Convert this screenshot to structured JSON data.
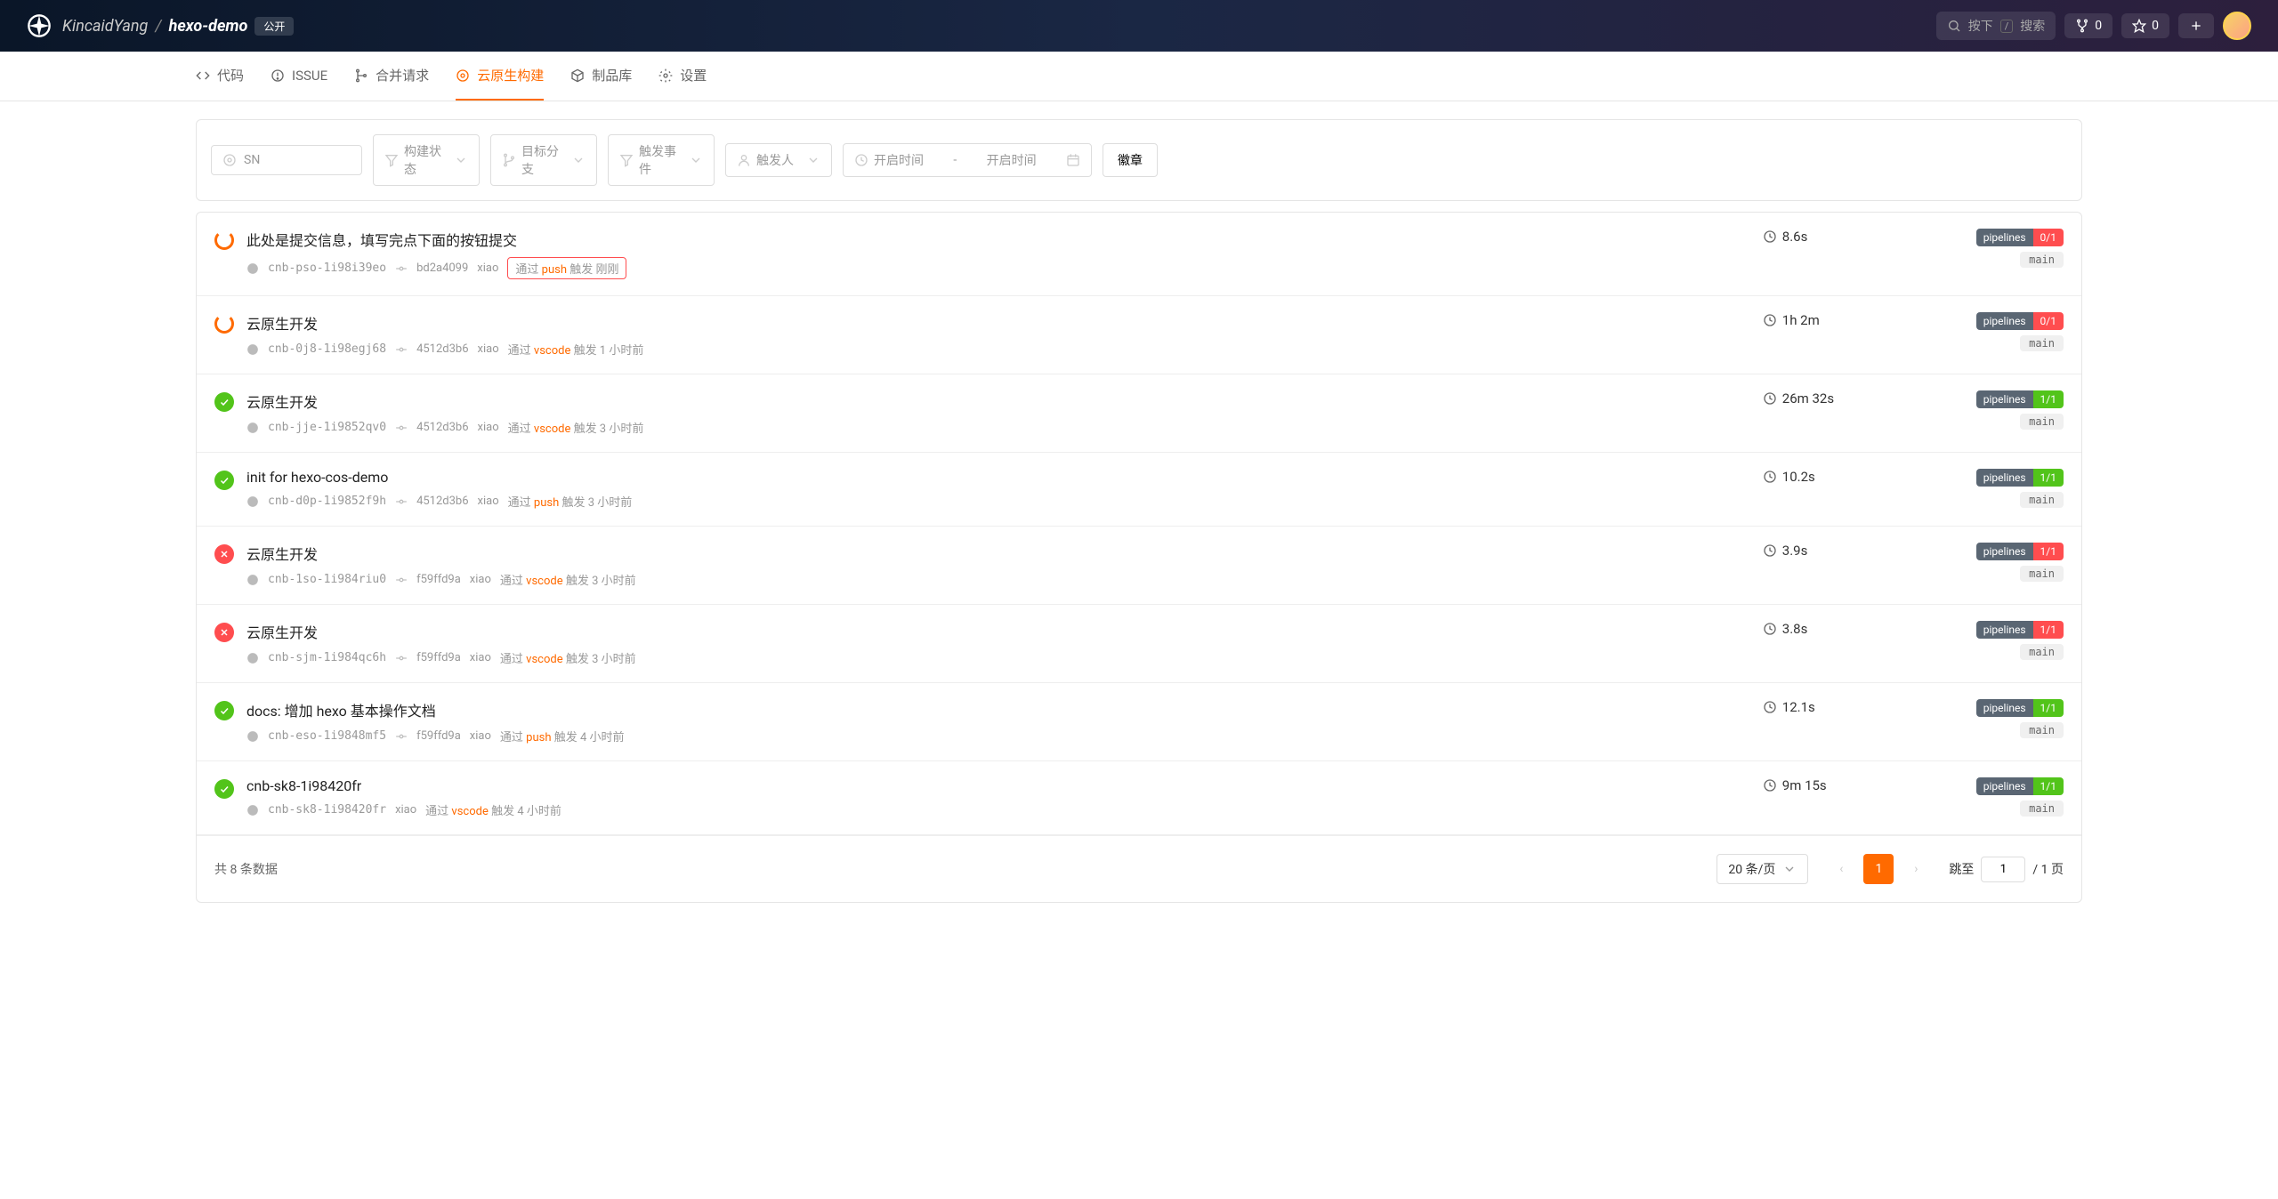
{
  "header": {
    "owner": "KincaidYang",
    "repo": "hexo-demo",
    "visibility": "公开",
    "search_placeholder": "按下",
    "search_suffix": "搜索",
    "fork_count": "0",
    "star_count": "0"
  },
  "tabs": {
    "code": "代码",
    "issue": "ISSUE",
    "pr": "合并请求",
    "build": "云原生构建",
    "artifact": "制品库",
    "settings": "设置"
  },
  "filters": {
    "sn_placeholder": "SN",
    "status": "构建状态",
    "branch": "目标分支",
    "event": "触发事件",
    "trigger": "触发人",
    "start_time": "开启时间",
    "end_time": "开启时间",
    "badge_btn": "徽章"
  },
  "builds": [
    {
      "status": "running",
      "title": "此处是提交信息，填写完点下面的按钮提交",
      "build_id": "cnb-pso-1i98i39eo",
      "commit": "bd2a4099",
      "user": "xiao",
      "trigger_prefix": "通过",
      "trigger_type": "push",
      "trigger_suffix": "触发 刚刚",
      "highlighted": true,
      "duration": "8.6s",
      "pipeline_count": "0/1",
      "pipeline_color": "red",
      "branch": "main"
    },
    {
      "status": "running",
      "title": "云原生开发",
      "build_id": "cnb-0j8-1i98egj68",
      "commit": "4512d3b6",
      "user": "xiao",
      "trigger_prefix": "通过",
      "trigger_type": "vscode",
      "trigger_suffix": "触发 1 小时前",
      "highlighted": false,
      "duration": "1h 2m",
      "pipeline_count": "0/1",
      "pipeline_color": "red",
      "branch": "main"
    },
    {
      "status": "success",
      "title": "云原生开发",
      "build_id": "cnb-jje-1i9852qv0",
      "commit": "4512d3b6",
      "user": "xiao",
      "trigger_prefix": "通过",
      "trigger_type": "vscode",
      "trigger_suffix": "触发 3 小时前",
      "highlighted": false,
      "duration": "26m 32s",
      "pipeline_count": "1/1",
      "pipeline_color": "green",
      "branch": "main"
    },
    {
      "status": "success",
      "title": "init for hexo-cos-demo",
      "build_id": "cnb-d0p-1i9852f9h",
      "commit": "4512d3b6",
      "user": "xiao",
      "trigger_prefix": "通过",
      "trigger_type": "push",
      "trigger_suffix": "触发 3 小时前",
      "highlighted": false,
      "duration": "10.2s",
      "pipeline_count": "1/1",
      "pipeline_color": "green",
      "branch": "main"
    },
    {
      "status": "fail",
      "title": "云原生开发",
      "build_id": "cnb-1so-1i984riu0",
      "commit": "f59ffd9a",
      "user": "xiao",
      "trigger_prefix": "通过",
      "trigger_type": "vscode",
      "trigger_suffix": "触发 3 小时前",
      "highlighted": false,
      "duration": "3.9s",
      "pipeline_count": "1/1",
      "pipeline_color": "red",
      "branch": "main"
    },
    {
      "status": "fail",
      "title": "云原生开发",
      "build_id": "cnb-sjm-1i984qc6h",
      "commit": "f59ffd9a",
      "user": "xiao",
      "trigger_prefix": "通过",
      "trigger_type": "vscode",
      "trigger_suffix": "触发 3 小时前",
      "highlighted": false,
      "duration": "3.8s",
      "pipeline_count": "1/1",
      "pipeline_color": "red",
      "branch": "main"
    },
    {
      "status": "success",
      "title": "docs: 增加 hexo 基本操作文档",
      "build_id": "cnb-eso-1i9848mf5",
      "commit": "f59ffd9a",
      "user": "xiao",
      "trigger_prefix": "通过",
      "trigger_type": "push",
      "trigger_suffix": "触发 4 小时前",
      "highlighted": false,
      "duration": "12.1s",
      "pipeline_count": "1/1",
      "pipeline_color": "green",
      "branch": "main"
    },
    {
      "status": "success",
      "title": "cnb-sk8-1i98420fr",
      "build_id": "cnb-sk8-1i98420fr",
      "commit": "",
      "user": "xiao",
      "trigger_prefix": "通过",
      "trigger_type": "vscode",
      "trigger_suffix": "触发 4 小时前",
      "highlighted": false,
      "duration": "9m 15s",
      "pipeline_count": "1/1",
      "pipeline_color": "green",
      "branch": "main"
    }
  ],
  "pagination": {
    "total_text": "共 8 条数据",
    "per_page": "20 条/页",
    "current": "1",
    "jump_prefix": "跳至",
    "jump_value": "1",
    "jump_suffix": "/ 1 页"
  },
  "labels": {
    "pipelines": "pipelines"
  }
}
